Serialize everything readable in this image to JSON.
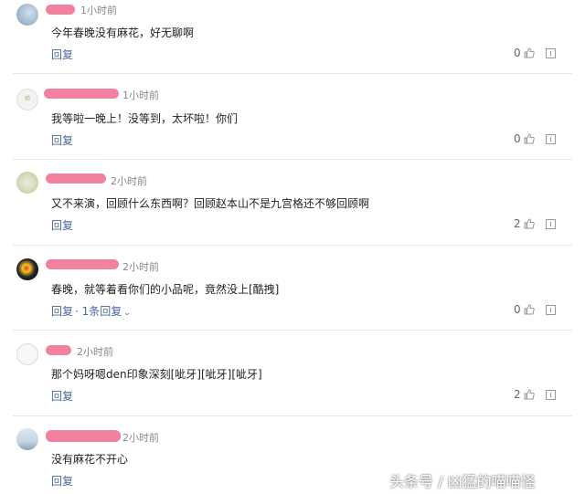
{
  "comments": [
    {
      "time": "1小时前",
      "text": "今年春晚没有麻花，好无聊啊",
      "reply_label": "回复",
      "likes": "0",
      "more": ""
    },
    {
      "time": "1小时前",
      "text": "我等啦一晚上！没等到，太坏啦！你们",
      "reply_label": "回复",
      "likes": "0",
      "more": ""
    },
    {
      "time": "2小时前",
      "text": "又不来演，回顾什么东西啊？回顾赵本山不是九宫格还不够回顾啊",
      "reply_label": "回复",
      "likes": "2",
      "more": ""
    },
    {
      "time": "2小时前",
      "text": "春晚，就等着看你们的小品呢，竟然没上[酷拽]",
      "reply_label": "回复",
      "likes": "0",
      "more": "· 1条回复"
    },
    {
      "time": "2小时前",
      "text": "那个妈呀嗯den印象深刻[呲牙][呲牙][呲牙]",
      "reply_label": "回复",
      "likes": "2",
      "more": ""
    },
    {
      "time": "2小时前",
      "text": "没有麻花不开心",
      "reply_label": "回复",
      "likes": "",
      "more": ""
    }
  ],
  "avatar_texts": {
    "c2": "帅"
  },
  "watermark": "头条号 / 凶猛的喵喵怪",
  "colors": {
    "link": "#4a6a9a",
    "name_redaction": "#f06b8e",
    "divider": "#e8e8e8"
  }
}
